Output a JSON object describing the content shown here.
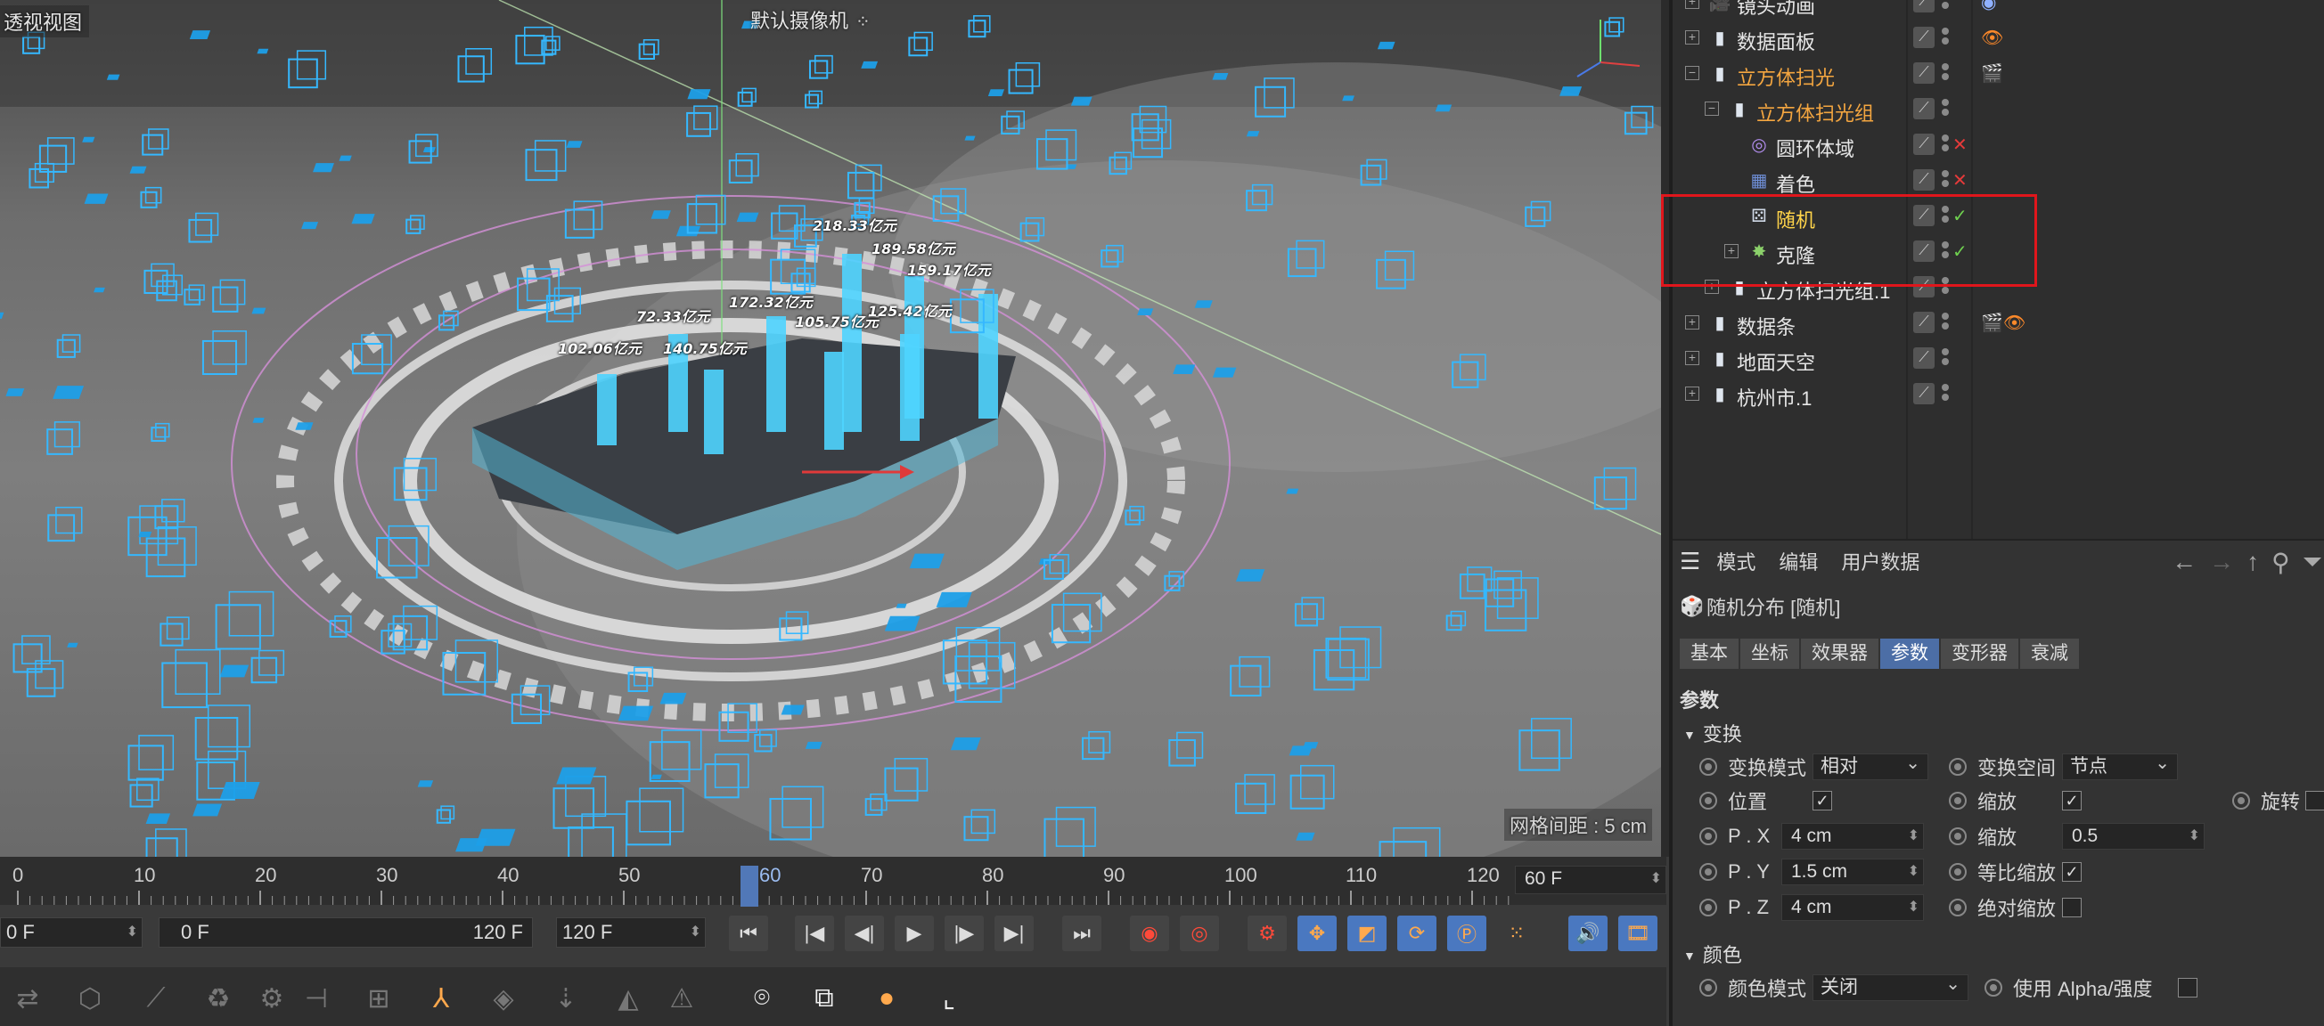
{
  "viewport": {
    "title": "透视视图",
    "camera": "默认摄像机",
    "camera_icon": "camera-dots-icon",
    "grid_spacing": "网格间距 : 5 cm",
    "data_labels": [
      "218.33亿元",
      "189.58亿元",
      "159.17亿元",
      "172.32亿元",
      "72.33亿元",
      "105.75亿元",
      "125.42亿元",
      "102.06亿元",
      "140.75亿元"
    ]
  },
  "object_tree": {
    "items": [
      {
        "label": "镜头动画",
        "color": "white",
        "icon": "camera-icon",
        "tag": "target-icon"
      },
      {
        "label": "数据面板",
        "color": "white",
        "icon": "null-icon",
        "tag": "eye-icon"
      },
      {
        "label": "立方体扫光",
        "color": "orange",
        "icon": "null-icon",
        "tag": "clapper-icon"
      },
      {
        "label": "立方体扫光组",
        "color": "orange",
        "icon": "null-icon",
        "tag": ""
      },
      {
        "label": "圆环体域",
        "color": "white",
        "icon": "torus-field-icon",
        "tag": "cross-icon"
      },
      {
        "label": "着色",
        "color": "white",
        "icon": "shader-icon",
        "tag": "cross-icon"
      },
      {
        "label": "随机",
        "color": "yellow",
        "icon": "random-effector-icon",
        "tag": "check-icon"
      },
      {
        "label": "克隆",
        "color": "white",
        "icon": "cloner-icon",
        "tag": "check-icon"
      },
      {
        "label": "立方体扫光组.1",
        "color": "white",
        "icon": "null-icon",
        "tag": ""
      },
      {
        "label": "数据条",
        "color": "white",
        "icon": "null-icon",
        "tag": "clapper-eye-icon"
      },
      {
        "label": "地面天空",
        "color": "white",
        "icon": "null-icon",
        "tag": ""
      },
      {
        "label": "杭州市.1",
        "color": "white",
        "icon": "null-icon",
        "tag": ""
      }
    ]
  },
  "attributes": {
    "menu": [
      "模式",
      "编辑",
      "用户数据"
    ],
    "object_title": "随机分布 [随机]",
    "tabs": [
      "基本",
      "坐标",
      "效果器",
      "参数",
      "变形器",
      "衰减"
    ],
    "active_tab": "参数",
    "section_params": "参数",
    "section_transform": "变换",
    "transform_mode_label": "变换模式",
    "transform_mode_value": "相对",
    "transform_space_label": "变换空间",
    "transform_space_value": "节点",
    "position_label": "位置",
    "scale_label": "缩放",
    "rotation_label": "旋转",
    "px_label": "P . X",
    "px_value": "4 cm",
    "py_label": "P . Y",
    "py_value": "1.5 cm",
    "pz_label": "P . Z",
    "pz_value": "4 cm",
    "scale2_label": "缩放",
    "scale2_value": "0.5",
    "uniform_scale_label": "等比缩放",
    "absolute_scale_label": "绝对缩放",
    "section_color": "颜色",
    "color_mode_label": "颜色模式",
    "color_mode_value": "关闭",
    "use_alpha_label": "使用 Alpha/强度",
    "check_mark": "✓"
  },
  "timeline": {
    "ticks": [
      "0",
      "10",
      "20",
      "30",
      "40",
      "50",
      "60",
      "70",
      "80",
      "90",
      "100",
      "110",
      "120"
    ],
    "playhead_label": "60",
    "current_frame": "60 F",
    "start_frame": "0 F",
    "range_start": "0 F",
    "range_end": "120 F",
    "end_frame": "120 F"
  }
}
